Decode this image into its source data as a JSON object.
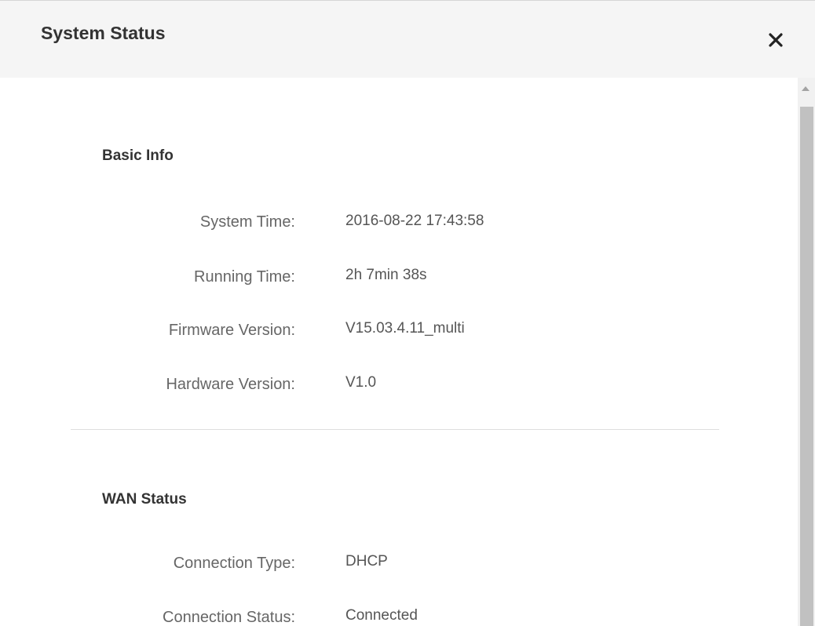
{
  "dialog": {
    "title": "System Status"
  },
  "basic_info": {
    "title": "Basic Info",
    "rows": [
      {
        "label": "System Time:",
        "value": "2016-08-22 17:43:58"
      },
      {
        "label": "Running Time:",
        "value": "2h 7min 38s"
      },
      {
        "label": "Firmware Version:",
        "value": "V15.03.4.11_multi"
      },
      {
        "label": "Hardware Version:",
        "value": "V1.0"
      }
    ]
  },
  "wan_status": {
    "title": "WAN Status",
    "rows": [
      {
        "label": "Connection Type:",
        "value": "DHCP"
      },
      {
        "label": "Connection Status:",
        "value": "Connected"
      }
    ]
  },
  "icons": {
    "close": "close-icon",
    "scroll_up": "scroll-up-arrow-icon"
  }
}
